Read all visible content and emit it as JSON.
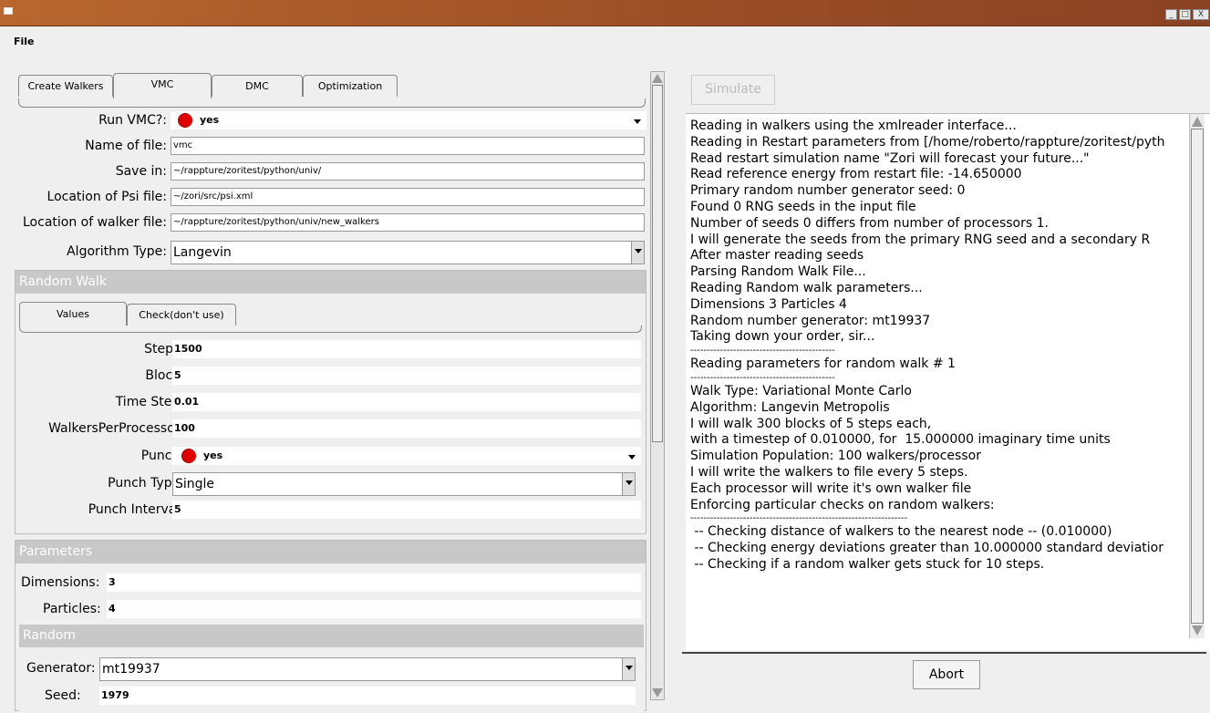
{
  "window": {
    "minimize_glyph": "_",
    "maximize_glyph": "□",
    "close_glyph": "X"
  },
  "menu": {
    "file": "File"
  },
  "tabs": [
    "Create Walkers",
    "VMC",
    "DMC",
    "Optimization"
  ],
  "vmc": {
    "run_label": "Run VMC?:",
    "run_value": "yes",
    "name_label": "Name of file:",
    "name_value": "vmc",
    "save_label": "Save in:",
    "save_value": "~/rappture/zoritest/python/univ/",
    "psi_label": "Location of Psi file:",
    "psi_value": "~/zori/src/psi.xml",
    "walker_label": "Location of walker file:",
    "walker_value": "~/rappture/zoritest/python/univ/new_walkers",
    "algo_label": "Algorithm Type:",
    "algo_value": "Langevin"
  },
  "random_walk": {
    "title": "Random Walk",
    "subtabs": [
      "Values",
      "Check(don't use)"
    ],
    "steps_label": "Steps:",
    "steps_value": "1500",
    "block_label": "Block:",
    "block_value": "5",
    "timestep_label": "Time Step:",
    "timestep_value": "0.01",
    "wpp_label": "WalkersPerProcessor:",
    "wpp_value": "100",
    "punch_label": "Punch:",
    "punch_value": "yes",
    "punchtype_label": "Punch Type:",
    "punchtype_value": "Single",
    "interval_label": "Punch Interval:",
    "interval_value": "5"
  },
  "parameters": {
    "title": "Parameters",
    "dims_label": "Dimensions:",
    "dims_value": "3",
    "particles_label": "Particles:",
    "particles_value": "4"
  },
  "random": {
    "title": "Random",
    "gen_label": "Generator:",
    "gen_value": "mt19937",
    "seed_label": "Seed:",
    "seed_value": "1979"
  },
  "simulate_label": "Simulate",
  "abort_label": "Abort",
  "output_lines": [
    "Reading in walkers using the xmlreader interface...",
    "Reading in Restart parameters from [/home/roberto/rappture/zoritest/pyth",
    "Read restart simulation name \"Zori will forecast your future...\"",
    "Read reference energy from restart file: -14.650000",
    "Primary random number generator seed: 0",
    "Found 0 RNG seeds in the input file",
    "Number of seeds 0 differs from number of processors 1.",
    "I will generate the seeds from the primary RNG seed and a secondary R",
    "After master reading seeds",
    "Parsing Random Walk File...",
    "Reading Random walk parameters...",
    "Dimensions 3 Particles 4",
    "Random number generator: mt19937",
    "Taking down your order, sir...",
    "--------------------------------------------",
    "Reading parameters for random walk # 1",
    "--------------------------------------------",
    "Walk Type: Variational Monte Carlo",
    "Algorithm: Langevin Metropolis",
    "I will walk 300 blocks of 5 steps each,",
    "with a timestep of 0.010000, for  15.000000 imaginary time units",
    "Simulation Population: 100 walkers/processor",
    "I will write the walkers to file every 5 steps.",
    "Each processor will write it's own walker file",
    "Enforcing particular checks on random walkers:",
    "------------------------------------------------------------------",
    " -- Checking distance of walkers to the nearest node -- (0.010000)",
    " -- Checking energy deviations greater than 10.000000 standard deviatior",
    " -- Checking if a random walker gets stuck for 10 steps."
  ]
}
